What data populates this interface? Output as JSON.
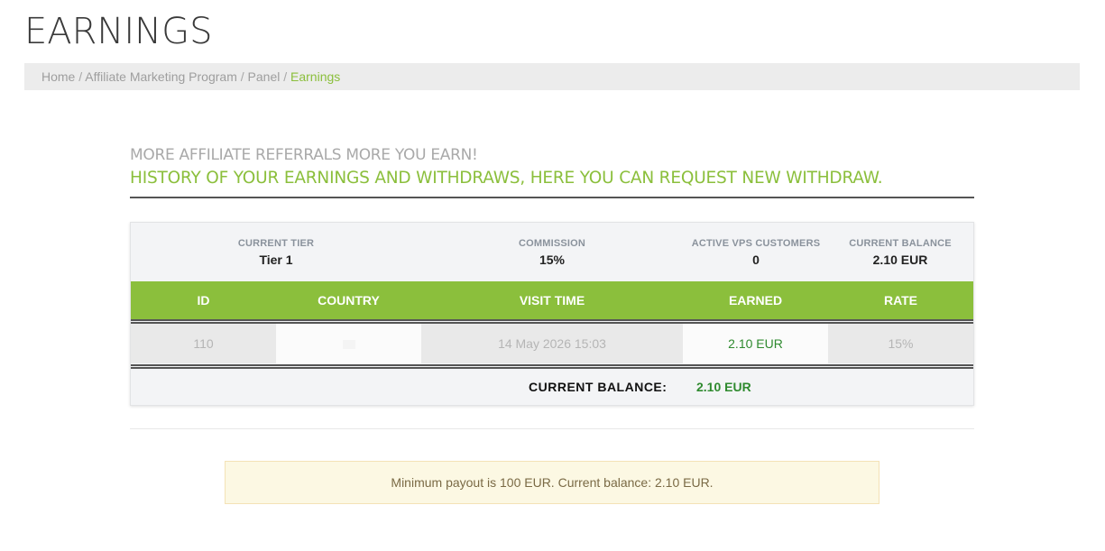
{
  "page": {
    "title": "EARNINGS"
  },
  "breadcrumb": {
    "items": [
      "Home",
      "Affiliate Marketing Program",
      "Panel"
    ],
    "separator": "/",
    "active": "Earnings"
  },
  "intro": {
    "subtitle": "MORE AFFILIATE REFERRALS MORE YOU EARN!",
    "headline": "HISTORY OF YOUR EARNINGS AND WITHDRAWS, HERE YOU CAN REQUEST NEW WITHDRAW."
  },
  "stats": [
    {
      "label": "CURRENT TIER",
      "value": "Tier 1"
    },
    {
      "label": "COMMISSION",
      "value": "15%"
    },
    {
      "label": "ACTIVE VPS CUSTOMERS",
      "value": "0"
    },
    {
      "label": "CURRENT BALANCE",
      "value": "2.10 EUR"
    }
  ],
  "table": {
    "columns": [
      "ID",
      "COUNTRY",
      "VISIT TIME",
      "EARNED",
      "RATE"
    ],
    "rows": [
      {
        "id": "110",
        "country_icon": "flag-icon",
        "visit_time": "14 May 2026 15:03",
        "earned": "2.10 EUR",
        "rate": "15%"
      }
    ]
  },
  "balance": {
    "label": "CURRENT BALANCE:",
    "value": "2.10 EUR"
  },
  "alert": {
    "message": "Minimum payout is 100 EUR. Current balance: 2.10 EUR."
  },
  "colors": {
    "accent": "#8bbf3c",
    "earned": "#2f8a2f",
    "alert_bg": "#fcf8e3"
  }
}
